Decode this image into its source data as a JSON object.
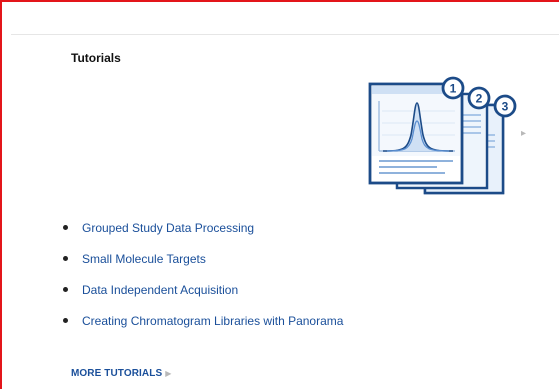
{
  "section": {
    "title": "Tutorials"
  },
  "illustration": {
    "badges": [
      "1",
      "2",
      "3"
    ],
    "icon": "tutorial-documents-illustration"
  },
  "tutorials": [
    {
      "label": "Grouped Study Data Processing"
    },
    {
      "label": "Small Molecule Targets"
    },
    {
      "label": "Data Independent Acquisition"
    },
    {
      "label": "Creating Chromatogram Libraries with Panorama"
    }
  ],
  "more_link": {
    "label": "MORE TUTORIALS",
    "icon": "chevron-right-icon"
  },
  "colors": {
    "frame": "#e3151a",
    "link": "#1a4f9a",
    "illustration_stroke": "#1c4b88",
    "illustration_fill": "#e8f1fb"
  }
}
